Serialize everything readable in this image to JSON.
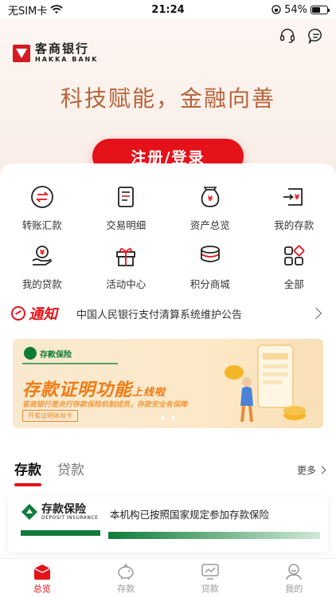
{
  "status_bar": {
    "carrier": "无SIM卡",
    "time": "21:24",
    "battery_text": "54%",
    "battery_level": 0.54
  },
  "header": {
    "logo_cn": "客商银行",
    "logo_en": "HAKKA BANK",
    "slogan": "科技赋能，金融向善",
    "login_label": "注册/登录"
  },
  "quick_actions": [
    {
      "label": "转账汇款",
      "icon": "transfer-icon"
    },
    {
      "label": "交易明细",
      "icon": "transaction-detail-icon"
    },
    {
      "label": "资产总览",
      "icon": "asset-overview-icon"
    },
    {
      "label": "我的存款",
      "icon": "my-deposit-icon"
    },
    {
      "label": "我的贷款",
      "icon": "my-loan-icon"
    },
    {
      "label": "活动中心",
      "icon": "gift-icon"
    },
    {
      "label": "积分商城",
      "icon": "points-mall-icon"
    },
    {
      "label": "全部",
      "icon": "all-apps-icon"
    }
  ],
  "notice": {
    "title": "通知",
    "text": "中国人民银行支付清算系统维护公告"
  },
  "banner": {
    "badge": "存款保险",
    "title_main": "存款证明功能",
    "title_small": "上线啦",
    "subtitle": "客商银行是央行存款保险机制成员，存款安全有保障",
    "cta": "开笔证明体验卡"
  },
  "product_tabs": {
    "tabs": [
      "存款",
      "贷款"
    ],
    "more_label": "更多"
  },
  "deposit_insurance": {
    "logo_cn": "存款保险",
    "logo_en": "DEPOSIT INSURANCE",
    "text": "本机构已按照国家规定参加存款保险"
  },
  "tabbar": {
    "items": [
      {
        "label": "总览",
        "active": true
      },
      {
        "label": "存款",
        "active": false
      },
      {
        "label": "贷款",
        "active": false
      },
      {
        "label": "我的",
        "active": false
      }
    ]
  },
  "colors": {
    "brand_red": "#e5121a",
    "slogan_gold": "#b7643b",
    "insurance_green": "#0f7c3a"
  }
}
